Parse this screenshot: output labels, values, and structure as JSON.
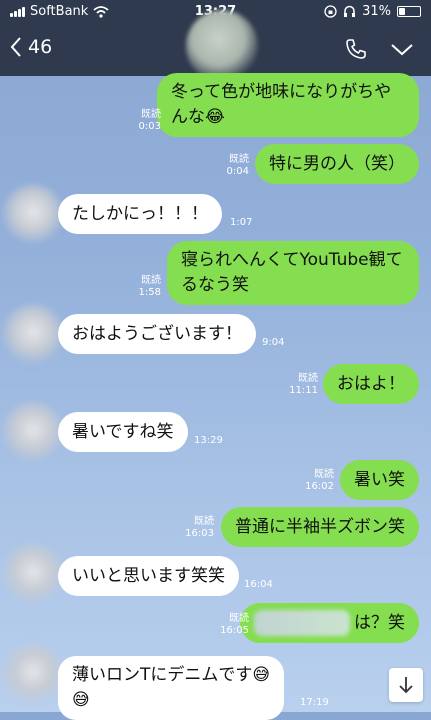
{
  "status": {
    "carrier": "SoftBank",
    "time": "13:27",
    "battery": "31%"
  },
  "header": {
    "back_count": "46"
  },
  "messages": [
    {
      "dir": "out",
      "text": "冬って色が地味になりがちゃんな😂",
      "line1": "冬って色が地味になりがちや",
      "line2": "んな😂",
      "read": "既読",
      "time": "0:03"
    },
    {
      "dir": "out",
      "text": "特に男の人（笑）",
      "read": "既読",
      "time": "0:04"
    },
    {
      "dir": "in",
      "text": "たしかにっ！！！",
      "time": "1:07"
    },
    {
      "dir": "out",
      "line1": "寝られへんくてYouTube観て",
      "line2": "るなう笑",
      "read": "既読",
      "time": "1:58"
    },
    {
      "dir": "in",
      "text": "おはようございます！",
      "time": "9:04"
    },
    {
      "dir": "out",
      "text": "おはよ！",
      "read": "既読",
      "time": "11:11"
    },
    {
      "dir": "in",
      "text": "暑いですね笑",
      "time": "13:29"
    },
    {
      "dir": "out",
      "text": "暑い笑",
      "read": "既読",
      "time": "16:02"
    },
    {
      "dir": "out",
      "text": "普通に半袖半ズボン笑",
      "read": "既読",
      "time": "16:03"
    },
    {
      "dir": "in",
      "text": "いいと思います笑笑",
      "time": "16:04"
    },
    {
      "dir": "out",
      "text": "は？笑",
      "read": "既読",
      "time": "16:05"
    },
    {
      "dir": "in",
      "line1": "薄いロンTにデニムです😅",
      "line2": "😅",
      "time": "17:19"
    }
  ]
}
